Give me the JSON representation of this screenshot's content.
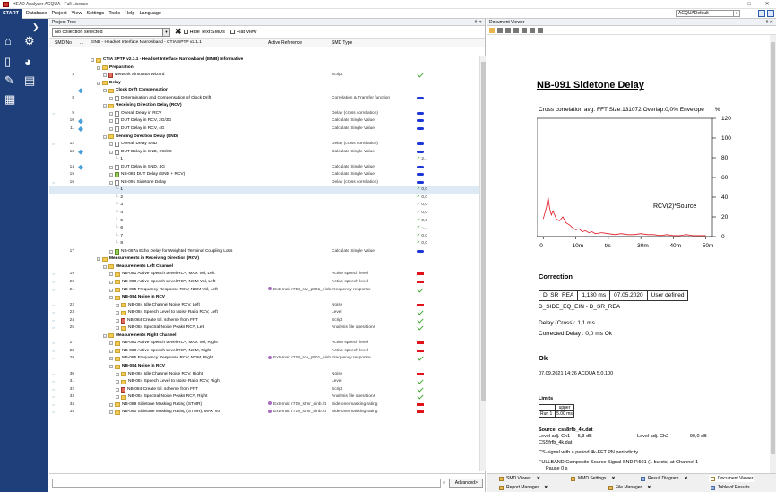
{
  "window": {
    "title": "HEAD Analyzer ACQUA - Full License",
    "controls": [
      "—",
      "□",
      "✕"
    ]
  },
  "menu": {
    "start": "START",
    "items": [
      "Database",
      "Project",
      "View",
      "Settings",
      "Tools",
      "Help",
      "Language"
    ],
    "profile": "ACQUADefault"
  },
  "project_tree": {
    "panel_title": "Project Tree",
    "pin": "# ✕",
    "collection": "No collection selected",
    "hide_text": "Hide Text SMDs",
    "flat_view": "Flat View",
    "columns": {
      "no": "SMD No",
      "dots": "...",
      "name": "EINB - Headset Interface Narrowband - CTIA SPTP v2.1.1",
      "ref": "Active Reference",
      "type": "SMD Type"
    },
    "rows": [
      {
        "no": "",
        "indent": 0,
        "icon": "folder",
        "text": "CTIA SPTP v2.1.1 - Headset Interface Narrowband (EINB) Informative",
        "bold": true
      },
      {
        "no": "",
        "indent": 1,
        "icon": "folder",
        "text": "Preparation",
        "bold": true
      },
      {
        "no": "3",
        "indent": 2,
        "icon": "red",
        "text": "Network Simulator Wizard",
        "type": "Script",
        "status": "chk"
      },
      {
        "no": "",
        "indent": 1,
        "icon": "folder",
        "text": "Delay",
        "bold": true
      },
      {
        "no": "",
        "indent": 2,
        "icon": "folder",
        "text": "Clock Drift Compensation",
        "bold": true,
        "ldot": true
      },
      {
        "no": "8",
        "indent": 3,
        "icon": "doc",
        "text": "Determination and Compensation of Clock Drift",
        "type": "Correlation & Transfer function",
        "status": "blue"
      },
      {
        "no": "",
        "indent": 2,
        "icon": "folder",
        "text": "Receiving Direction Delay (RCV)",
        "bold": true
      },
      {
        "no": "9",
        "indent": 3,
        "icon": "doc",
        "text": "Overall Delay in RCV",
        "type": "Delay (cross correlation)",
        "status": "blue",
        "arrow": true
      },
      {
        "no": "10",
        "indent": 3,
        "icon": "doc",
        "text": "DUT Delay in RCV, 2G/3G",
        "type": "Calculate Single Value",
        "status": "blue",
        "ldot": true
      },
      {
        "no": "11",
        "indent": 3,
        "icon": "doc",
        "text": "DUT Delay in RCV, 4G",
        "type": "Calculate Single Value",
        "status": "blue",
        "ldot": true
      },
      {
        "no": "",
        "indent": 2,
        "icon": "folder",
        "text": "Sending Direction Delay (SND)",
        "bold": true
      },
      {
        "no": "12",
        "indent": 3,
        "icon": "doc",
        "text": "Overall Delay SND",
        "type": "Delay (cross correlation)",
        "status": "blue",
        "arrow": true
      },
      {
        "no": "13",
        "indent": 3,
        "icon": "doc",
        "text": "DUT Delay in SND, 2G/3G",
        "type": "Calculate Single Value",
        "status": "blue",
        "ldot": true
      },
      {
        "no": "",
        "indent": 4,
        "icon": "none",
        "text": "1",
        "val": "2..."
      },
      {
        "no": "14",
        "indent": 3,
        "icon": "doc",
        "text": "DUT Delay in SND, 4G",
        "type": "Calculate Single Value",
        "status": "blue",
        "ldot": true
      },
      {
        "no": "15",
        "indent": 3,
        "icon": "grn",
        "text": "NB-088 DUT Delay (SND + RCV)",
        "type": "Calculate Single Value",
        "status": "blue"
      },
      {
        "no": "16",
        "indent": 3,
        "icon": "doc",
        "text": "NB-091 Sidetone Delay",
        "type": "Delay (cross correlation)",
        "status": "blue",
        "arrow": true
      },
      {
        "no": "",
        "indent": 4,
        "icon": "none",
        "text": "1",
        "val": "0,0",
        "sel": true
      },
      {
        "no": "",
        "indent": 4,
        "icon": "none",
        "text": "2",
        "val": "0,0"
      },
      {
        "no": "",
        "indent": 4,
        "icon": "none",
        "text": "3",
        "val": "0,0"
      },
      {
        "no": "",
        "indent": 4,
        "icon": "none",
        "text": "4",
        "val": "0,0"
      },
      {
        "no": "",
        "indent": 4,
        "icon": "none",
        "text": "5",
        "val": "0,0"
      },
      {
        "no": "",
        "indent": 4,
        "icon": "none",
        "text": "6",
        "val": "-..."
      },
      {
        "no": "",
        "indent": 4,
        "icon": "none",
        "text": "7",
        "val": "0,0"
      },
      {
        "no": "",
        "indent": 4,
        "icon": "none",
        "text": "8",
        "val": "0,0"
      },
      {
        "no": "17",
        "indent": 3,
        "icon": "grn",
        "text": "NB-087a Echo Delay for Weighted Terminal Coupling Loss",
        "type": "Calculate Single Value",
        "status": "blue"
      },
      {
        "no": "",
        "indent": 1,
        "icon": "folder",
        "text": "Measurements in Receiving Direction (RCV)",
        "bold": true
      },
      {
        "no": "",
        "indent": 2,
        "icon": "folder",
        "text": "Measurements Left Channel",
        "bold": true
      },
      {
        "no": "19",
        "indent": 3,
        "icon": "folder",
        "text": "NB-081 Active Speech Level RCV, MAX Vol, Left",
        "type": "Active speech level",
        "status": "red",
        "arrow": true
      },
      {
        "no": "20",
        "indent": 3,
        "icon": "folder",
        "text": "NB-080 Active Speech Level RCV, NOM Vol, Left",
        "type": "Active speech level",
        "status": "red",
        "arrow": true
      },
      {
        "no": "21",
        "indent": 3,
        "icon": "folder",
        "text": "NB-085 Frequency Response RCV, NOM Vol, Left",
        "ref": "External: r718_rcv_p501_einb...",
        "type": "Frequency response",
        "status": "chk",
        "arrow": true
      },
      {
        "no": "",
        "indent": 3,
        "icon": "folder",
        "text": "NB-084 Noise in RCV",
        "bold": true
      },
      {
        "no": "22",
        "indent": 4,
        "icon": "folder",
        "text": "NB-084 Idle Channel Noise RCV, Left",
        "type": "Noise",
        "status": "red",
        "arrow": true
      },
      {
        "no": "23",
        "indent": 4,
        "icon": "folder",
        "text": "NB-084 Speech Level to Noise Ratio RCV, Left",
        "type": "Level",
        "status": "chk",
        "arrow": true
      },
      {
        "no": "24",
        "indent": 4,
        "icon": "red",
        "text": "NB-084 Create tol. scheme from FFT",
        "type": "Script",
        "status": "chk",
        "arrow": true
      },
      {
        "no": "25",
        "indent": 4,
        "icon": "folder",
        "text": "NB-084 Spectral Noise Peaks RCV, Left",
        "type": "Analysis file operations",
        "status": "chk",
        "arrow": true
      },
      {
        "no": "",
        "indent": 2,
        "icon": "folder",
        "text": "Measurements Right Channel",
        "bold": true
      },
      {
        "no": "27",
        "indent": 3,
        "icon": "folder",
        "text": "NB-081 Active Speech Level RCV, MAX Vol, Right",
        "type": "Active speech level",
        "status": "red",
        "arrow": true
      },
      {
        "no": "28",
        "indent": 3,
        "icon": "folder",
        "text": "NB-080 Active Speech Level RCV, NOM, Right",
        "type": "Active speech level",
        "status": "red",
        "arrow": true
      },
      {
        "no": "29",
        "indent": 3,
        "icon": "folder",
        "text": "NB-085 Frequency Response RCV, NOM, Right",
        "ref": "External: r718_rcv_p501_einb...",
        "type": "Frequency response",
        "status": "chk",
        "arrow": true
      },
      {
        "no": "",
        "indent": 3,
        "icon": "folder",
        "text": "NB-084 Noise in RCV",
        "bold": true
      },
      {
        "no": "30",
        "indent": 4,
        "icon": "folder",
        "text": "NB-084 Idle Channel Noise RCV, Right",
        "type": "Noise",
        "status": "red",
        "arrow": true
      },
      {
        "no": "31",
        "indent": 4,
        "icon": "folder",
        "text": "NB-084 Speech Level to Noise Ratio RCV, Right",
        "type": "Level",
        "status": "chk",
        "arrow": true
      },
      {
        "no": "32",
        "indent": 4,
        "icon": "red",
        "text": "NB-084 Create tol. scheme from FFT",
        "type": "Script",
        "status": "chk",
        "arrow": true
      },
      {
        "no": "33",
        "indent": 4,
        "icon": "folder",
        "text": "NB-084 Spectral Noise Peaks RCV, Right",
        "type": "Analysis file operations",
        "status": "chk",
        "arrow": true
      },
      {
        "no": "34",
        "indent": 3,
        "icon": "folder",
        "text": "NB-089 Sidetone Masking Rating (STMR)",
        "ref": "External: r719_stmr_einb.ftt",
        "type": "Sidetone masking rating",
        "status": "red",
        "arrow": true
      },
      {
        "no": "35",
        "indent": 3,
        "icon": "folder",
        "text": "NB-090 Sidetone Masking Rating (STMR), MAX Vol",
        "ref": "External: r719_stmr_einb.ftt",
        "type": "Sidetone masking rating",
        "status": "red",
        "arrow": true
      }
    ],
    "advanced": "Advanced>"
  },
  "document_viewer": {
    "panel_title": "Document Viewer",
    "pin": "# ✕",
    "heading": "NB-091 Sidetone Delay",
    "chart_caption": "Cross correlation avg.  FFT Size:131072  Overlap:0,0%  Envelope",
    "chart_data": {
      "type": "line",
      "y_unit": "%",
      "y_ticks": [
        "120",
        "100",
        "80",
        "60",
        "40",
        "20",
        "0"
      ],
      "x_ticks": [
        "0",
        "10m",
        "t/s",
        "30m",
        "40m",
        "50m"
      ],
      "ylim": [
        0,
        120
      ],
      "xlim": [
        -0.002,
        0.052
      ],
      "series": [
        {
          "name": "RCV(2)*Source",
          "color": "#e0141d",
          "x": [
            0,
            0.0005,
            0.001,
            0.0015,
            0.002,
            0.0025,
            0.003,
            0.004,
            0.005,
            0.006,
            0.007,
            0.008,
            0.009,
            0.01,
            0.011,
            0.012,
            0.013,
            0.014,
            0.015,
            0.016,
            0.018,
            0.02,
            0.022,
            0.024,
            0.026,
            0.028,
            0.03,
            0.032,
            0.034,
            0.036,
            0.038,
            0.04,
            0.042,
            0.044,
            0.046,
            0.048,
            0.05
          ],
          "y": [
            18,
            24,
            30,
            40,
            28,
            22,
            26,
            18,
            16,
            20,
            14,
            12,
            9,
            7,
            8,
            5,
            6,
            4,
            5,
            3,
            4,
            3,
            2,
            3,
            2,
            2,
            3,
            2,
            2,
            1,
            2,
            1,
            1,
            2,
            1,
            1,
            1
          ]
        }
      ]
    },
    "correction_heading": "Correction",
    "corr_table": [
      "D_SR_REA",
      "1,130 ms",
      "07.05.2020",
      "User defined"
    ],
    "corr_formula": "D_SIDE_EQ_EIN - D_SR_REA",
    "delay_cross": "Delay (Cross): 1,1 ms",
    "corrected_delay": "Corrected Delay : 0,0 ms Ok",
    "ok_heading": "Ok",
    "timestamp": "07.09.2021 14:26   ACQUA 5.0.100",
    "limits": {
      "title": "Limits",
      "col": "upper",
      "run": "Run 1",
      "val": "5.00 ms"
    },
    "source": {
      "title": "Source: css8rfb_4k.dat",
      "line1a": "Level adj. Ch1",
      "line1b": "-5,3 dB",
      "line1c": "Level adj. Ch2",
      "line1d": "-90,0 dB",
      "line2": "CSSfrfb_4k.dat",
      "line3": "CS-signal with a period 4k-FFT PN periodicity.",
      "line4": "FULLBAND Composite Source Signal SND P.501 (1 bursts) at Channel 1",
      "line5": "Pause  0 s"
    },
    "bottom_tabs": [
      {
        "label": "SMD Viewer"
      },
      {
        "label": "MMD Settings"
      },
      {
        "label": "Result Diagram"
      },
      {
        "label": "Document Viewer"
      },
      {
        "label": "Report Manager"
      },
      {
        "label": "File Manager"
      },
      {
        "label": "Table of Results"
      }
    ]
  }
}
